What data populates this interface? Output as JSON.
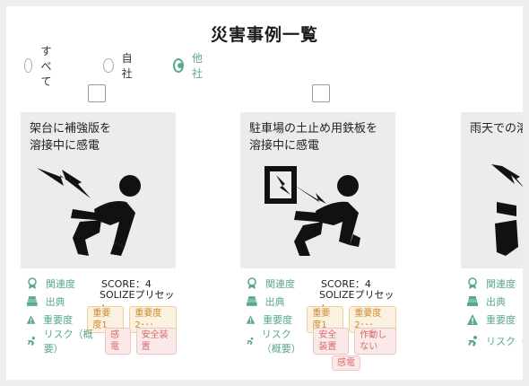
{
  "header": {
    "title": "災害事例一覧"
  },
  "filters": [
    {
      "label": "すべて",
      "selected": false
    },
    {
      "label": "自社",
      "selected": false
    },
    {
      "label": "他社",
      "selected": true
    }
  ],
  "field_labels": {
    "relevance": "関連度",
    "source": "出典",
    "severity": "重要度",
    "risk": "リスク（概要）"
  },
  "accent_color": "#5aa894",
  "cards": [
    {
      "caption": "架台に補強版を\n溶接中に感電",
      "illustration_icon": "electric-shock-person-icon",
      "score": "SCORE：4",
      "source": "SOLIZEプリセット",
      "severity_tags": [
        "重要度1",
        "重要度2･･･"
      ],
      "risk_tags": [
        "感電",
        "安全装置"
      ]
    },
    {
      "caption": "駐車場の土止め用鉄板を\n溶接中に感電",
      "illustration_icon": "electric-panel-shock-person-icon",
      "score": "SCORE：4",
      "source": "SOLIZEプリセット",
      "severity_tags": [
        "重要度1",
        "重要度2･･･"
      ],
      "risk_tags": [
        "安全装置",
        "作動しない",
        "感電"
      ]
    },
    {
      "caption": "雨天での溶",
      "illustration_icon": "electric-shock-person-icon",
      "score": "",
      "source": "",
      "severity_tags": [],
      "risk_tags": []
    }
  ]
}
